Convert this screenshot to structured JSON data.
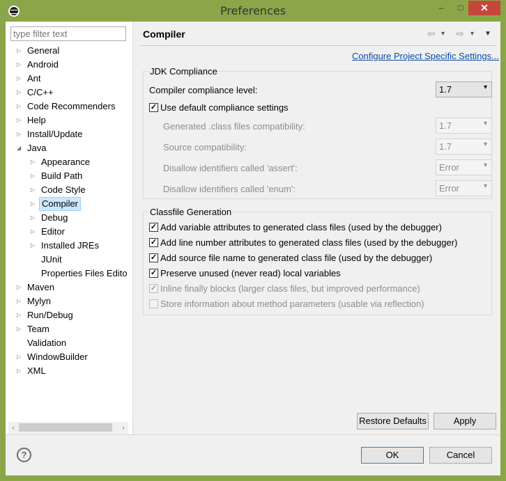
{
  "window": {
    "title": "Preferences",
    "min_glyph": "–",
    "max_glyph": "□",
    "close_glyph": "✕"
  },
  "filter": {
    "placeholder": "type filter text"
  },
  "tree": [
    {
      "label": "General",
      "twist": "▷"
    },
    {
      "label": "Android",
      "twist": "▷"
    },
    {
      "label": "Ant",
      "twist": "▷"
    },
    {
      "label": "C/C++",
      "twist": "▷"
    },
    {
      "label": "Code Recommenders",
      "twist": "▷"
    },
    {
      "label": "Help",
      "twist": "▷"
    },
    {
      "label": "Install/Update",
      "twist": "▷"
    },
    {
      "label": "Java",
      "twist": "◢"
    },
    {
      "label": "Appearance",
      "twist": "▷"
    },
    {
      "label": "Build Path",
      "twist": "▷"
    },
    {
      "label": "Code Style",
      "twist": "▷"
    },
    {
      "label": "Compiler",
      "twist": "▷"
    },
    {
      "label": "Debug",
      "twist": "▷"
    },
    {
      "label": "Editor",
      "twist": "▷"
    },
    {
      "label": "Installed JREs",
      "twist": "▷"
    },
    {
      "label": "JUnit",
      "twist": ""
    },
    {
      "label": "Properties Files Edito",
      "twist": ""
    },
    {
      "label": "Maven",
      "twist": "▷"
    },
    {
      "label": "Mylyn",
      "twist": "▷"
    },
    {
      "label": "Run/Debug",
      "twist": "▷"
    },
    {
      "label": "Team",
      "twist": "▷"
    },
    {
      "label": "Validation",
      "twist": ""
    },
    {
      "label": "WindowBuilder",
      "twist": "▷"
    },
    {
      "label": "XML",
      "twist": "▷"
    }
  ],
  "selected_tree_item": "Compiler",
  "scroll": {
    "left": "‹",
    "right": "›"
  },
  "page": {
    "title": "Compiler",
    "nav": {
      "back": "⇦",
      "back_menu": "▾",
      "forward": "⇨",
      "forward_menu": "▾",
      "view_menu": "▼"
    },
    "configure_link": "Configure Project Specific Settings...",
    "jdk": {
      "legend": "JDK Compliance",
      "compliance_label": "Compiler compliance level:",
      "compliance_value": "1.7",
      "use_default_label": "Use default compliance settings",
      "use_default_checked": true,
      "generated_label": "Generated .class files compatibility:",
      "generated_value": "1.7",
      "source_label": "Source compatibility:",
      "source_value": "1.7",
      "assert_label": "Disallow identifiers called 'assert':",
      "assert_value": "Error",
      "enum_label": "Disallow identifiers called 'enum':",
      "enum_value": "Error"
    },
    "classfile": {
      "legend": "Classfile Generation",
      "options": [
        {
          "label": "Add variable attributes to generated class files (used by the debugger)",
          "checked": true,
          "enabled": true
        },
        {
          "label": "Add line number attributes to generated class files (used by the debugger)",
          "checked": true,
          "enabled": true
        },
        {
          "label": "Add source file name to generated class file (used by the debugger)",
          "checked": true,
          "enabled": true
        },
        {
          "label": "Preserve unused (never read) local variables",
          "checked": true,
          "enabled": true
        },
        {
          "label": "Inline finally blocks (larger class files, but improved performance)",
          "checked": true,
          "enabled": false
        },
        {
          "label": "Store information about method parameters (usable via reflection)",
          "checked": false,
          "enabled": false
        }
      ]
    },
    "restore_defaults": "Restore Defaults",
    "apply": "Apply"
  },
  "dialog": {
    "help_glyph": "?",
    "ok": "OK",
    "cancel": "Cancel"
  },
  "colors": {
    "frame": "#8aa648",
    "close": "#c7463c",
    "link": "#0b4ba8",
    "selection": "#cce8ff"
  }
}
